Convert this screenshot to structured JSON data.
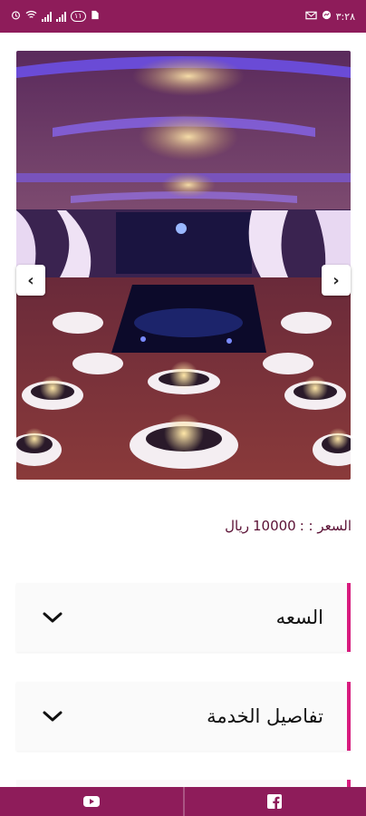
{
  "status_bar": {
    "time": "٣:٢٨",
    "battery_label": "١١",
    "icons": [
      "alarm-icon",
      "wifi-icon",
      "signal-icon",
      "signal-icon",
      "battery-icon",
      "sim-icon",
      "messenger-icon",
      "email-icon"
    ]
  },
  "gallery": {
    "prev_label": "‹",
    "next_label": "›"
  },
  "price": {
    "label": "السعر : :",
    "value": "10000",
    "currency": "ريال"
  },
  "sections": [
    {
      "title": "السعه"
    },
    {
      "title": "تفاصيل الخدمة"
    }
  ],
  "footer": {
    "links": [
      "youtube-icon",
      "facebook-icon"
    ]
  },
  "colors": {
    "brand": "#8e1c5a",
    "accent": "#d81b7e",
    "price_text": "#5a1034"
  }
}
